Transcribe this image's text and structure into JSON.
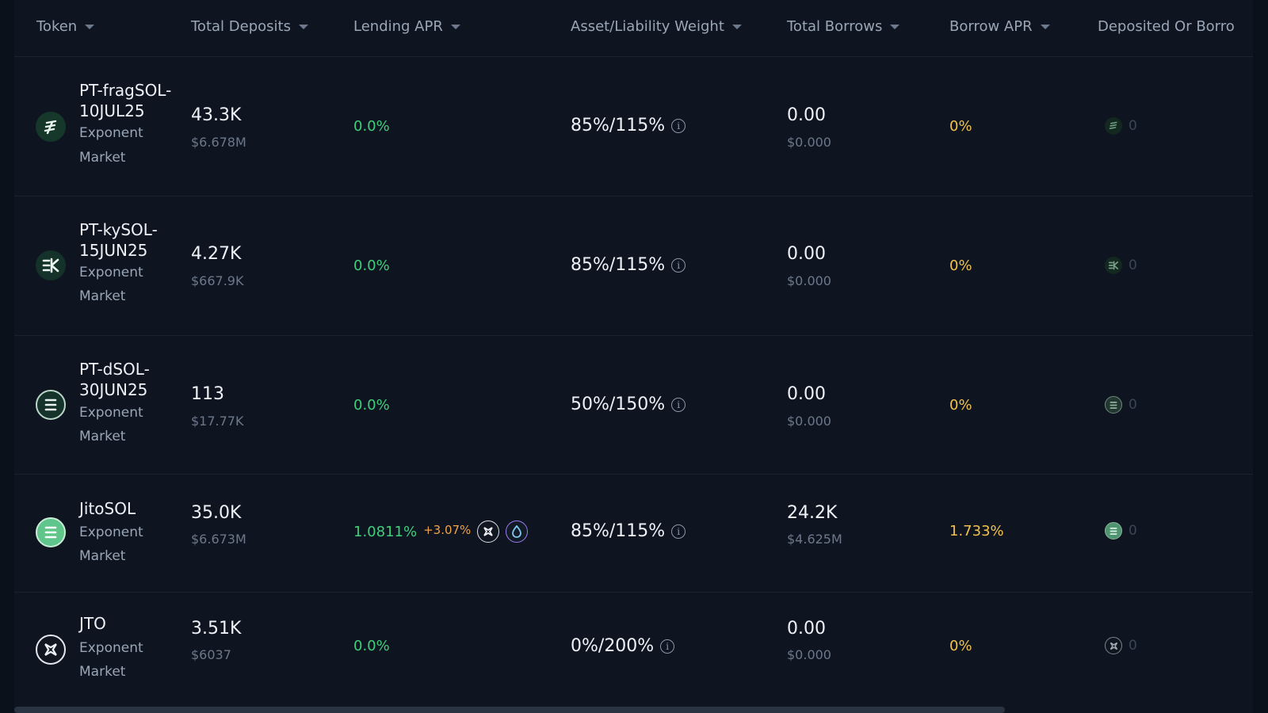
{
  "columns": [
    {
      "label": "Token"
    },
    {
      "label": "Total Deposits"
    },
    {
      "label": "Lending APR"
    },
    {
      "label": "Asset/Liability Weight"
    },
    {
      "label": "Total Borrows"
    },
    {
      "label": "Borrow APR"
    },
    {
      "label": "Deposited Or Borro"
    }
  ],
  "rows": [
    {
      "symbol": "PT-fragSOL-\n10JUL25",
      "market": "Exponent",
      "market2": "Market",
      "icon": "fragsol-icon",
      "deposits": "43.3K",
      "deposits_usd": "$6.678M",
      "lending_apr": "0.0%",
      "weight": "85%/115%",
      "borrows": "0.00",
      "borrows_usd": "$0.000",
      "borrow_apr": "0%",
      "deposited": "0"
    },
    {
      "symbol": "PT-kySOL-\n15JUN25",
      "market": "Exponent",
      "market2": "Market",
      "icon": "kysol-icon",
      "deposits": "4.27K",
      "deposits_usd": "$667.9K",
      "lending_apr": "0.0%",
      "weight": "85%/115%",
      "borrows": "0.00",
      "borrows_usd": "$0.000",
      "borrow_apr": "0%",
      "deposited": "0"
    },
    {
      "symbol": "PT-dSOL-\n30JUN25",
      "market": "Exponent",
      "market2": "Market",
      "icon": "dsol-icon",
      "deposits": "113",
      "deposits_usd": "$17.77K",
      "lending_apr": "0.0%",
      "weight": "50%/150%",
      "borrows": "0.00",
      "borrows_usd": "$0.000",
      "borrow_apr": "0%",
      "deposited": "0"
    },
    {
      "symbol": "JitoSOL",
      "market": "Exponent",
      "market2": "Market",
      "icon": "jitosol-icon",
      "deposits": "35.0K",
      "deposits_usd": "$6.673M",
      "lending_apr": "1.0811%",
      "lending_bonus": "+3.07%",
      "weight": "85%/115%",
      "borrows": "24.2K",
      "borrows_usd": "$4.625M",
      "borrow_apr": "1.733%",
      "deposited": "0"
    },
    {
      "symbol": "JTO",
      "market": "Exponent",
      "market2": "Market",
      "icon": "jto-icon",
      "deposits": "3.51K",
      "deposits_usd": "$6037",
      "lending_apr": "0.0%",
      "weight": "0%/200%",
      "borrows": "0.00",
      "borrows_usd": "$0.000",
      "borrow_apr": "0%",
      "deposited": "0"
    }
  ],
  "colors": {
    "background": "#0b111b",
    "green": "#3fcf7c",
    "gold": "#f2c14e",
    "orange": "#f0a24a"
  }
}
